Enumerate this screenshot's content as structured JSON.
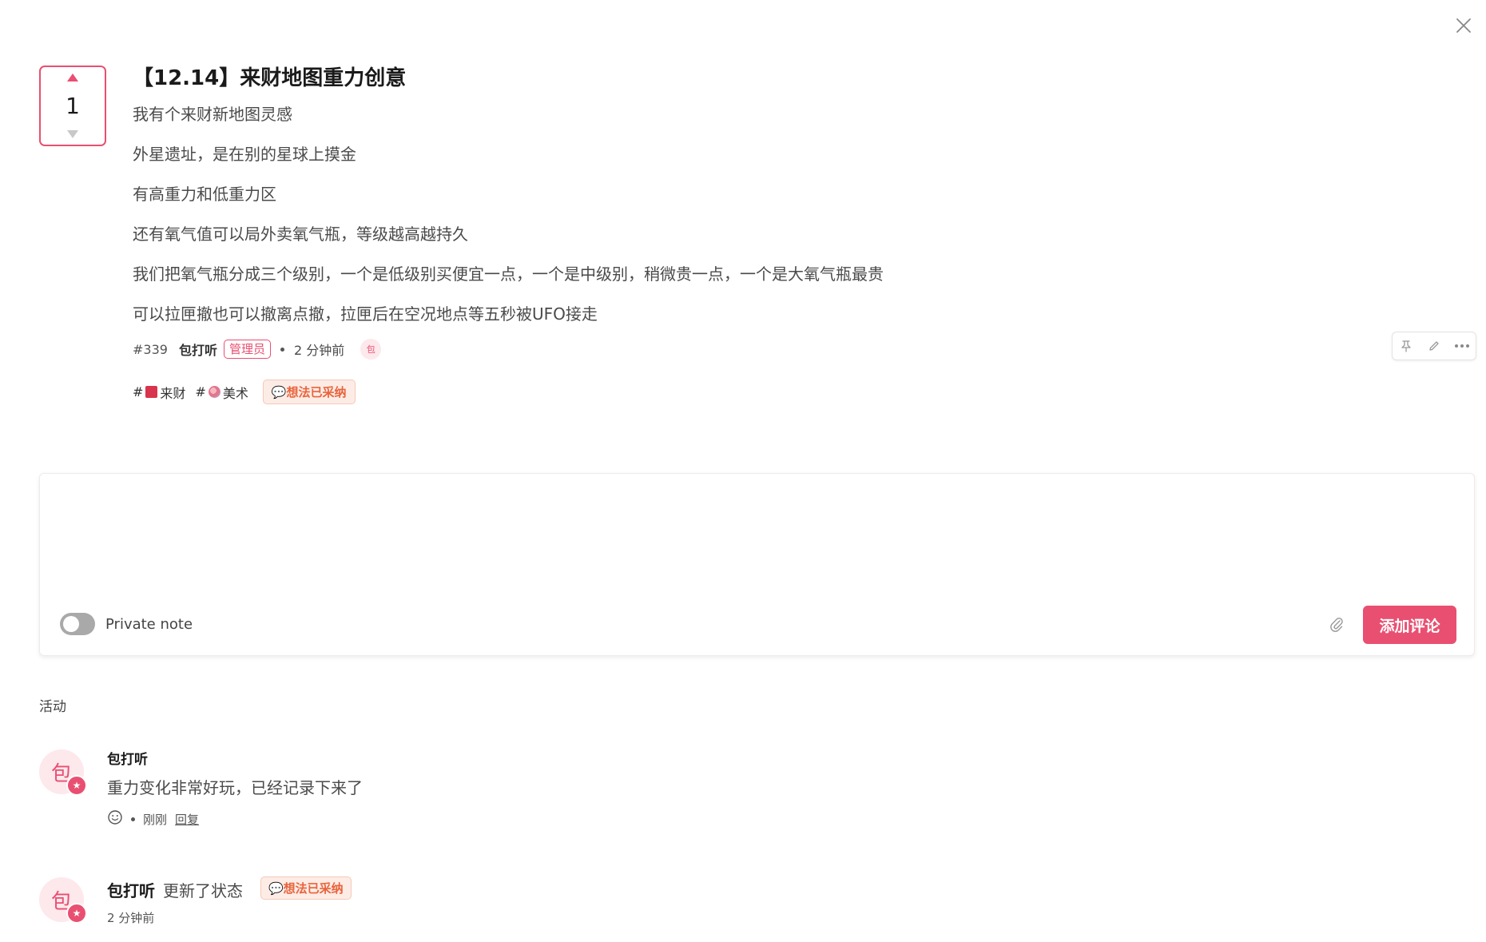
{
  "post": {
    "title": "【12.14】来财地图重力创意",
    "body_lines": [
      "我有个来财新地图灵感",
      "外星遗址，是在别的星球上摸金",
      "有高重力和低重力区",
      "还有氧气值可以局外卖氧气瓶，等级越高越持久",
      "我们把氧气瓶分成三个级别，一个是低级别买便宜一点，一个是中级别，稍微贵一点，一个是大氧气瓶最贵",
      "可以拉匣撤也可以撤离点撤，拉匣后在空况地点等五秒被UFO接走"
    ],
    "vote_count": "1",
    "id": "#339",
    "author": "包打听",
    "role_badge": "管理员",
    "time": "2 分钟前",
    "mini_avatar": "包",
    "tags": [
      {
        "hash": "#",
        "label": "来财",
        "icon": "red-envelope-icon"
      },
      {
        "hash": "#",
        "label": "美术",
        "icon": "palette-icon"
      }
    ],
    "status": "💬想法已采纳",
    "status_icon": "sunglasses-icon"
  },
  "comment": {
    "placeholder": "",
    "private_label": "Private note",
    "submit_label": "添加评论"
  },
  "activity": {
    "title": "活动",
    "items": [
      {
        "avatar": "包",
        "name": "包打听",
        "text": "重力变化非常好玩，已经记录下来了",
        "time": "刚刚",
        "reply": "回复"
      },
      {
        "avatar": "包",
        "name": "包打听",
        "action": "更新了状态",
        "status": "💬想法已采纳",
        "time": "2 分钟前"
      }
    ]
  },
  "colors": {
    "accent": "#e94f71",
    "status_text": "#e8643c",
    "status_bg": "#fdece6"
  }
}
